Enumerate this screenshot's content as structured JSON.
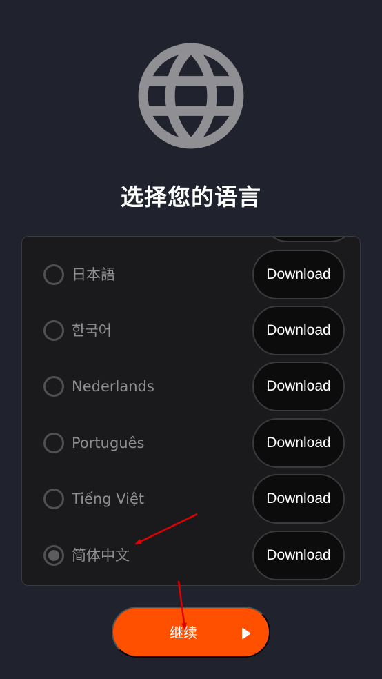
{
  "header": {
    "icon": "globe-icon",
    "title": "选择您的语言"
  },
  "languages": [
    {
      "label": "日本語",
      "selected": false,
      "download_label": "Download"
    },
    {
      "label": "한국어",
      "selected": false,
      "download_label": "Download"
    },
    {
      "label": "Nederlands",
      "selected": false,
      "download_label": "Download"
    },
    {
      "label": "Português",
      "selected": false,
      "download_label": "Download"
    },
    {
      "label": "Tiếng Việt",
      "selected": false,
      "download_label": "Download"
    },
    {
      "label": "简体中文",
      "selected": true,
      "download_label": "Download"
    }
  ],
  "continue": {
    "label": "继续",
    "icon": "play-icon"
  },
  "colors": {
    "background": "#20222d",
    "accent": "#ff5000",
    "annotation": "#e00000"
  }
}
